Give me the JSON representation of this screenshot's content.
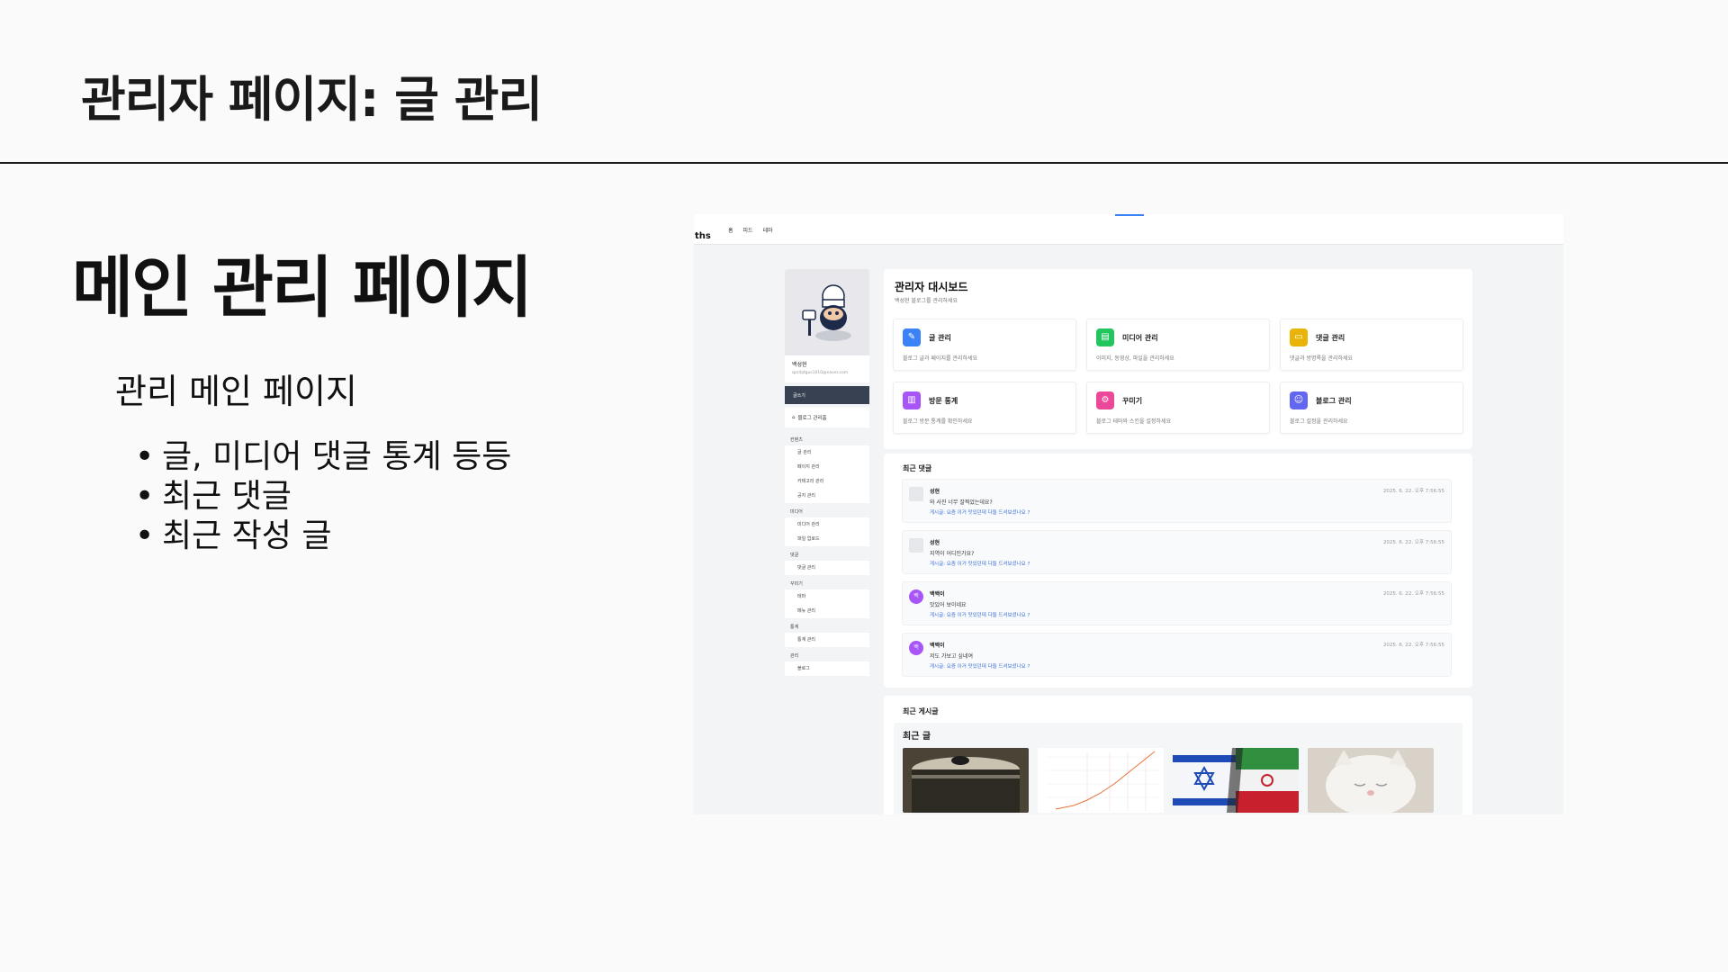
{
  "slide": {
    "title": "관리자 페이지: 글 관리",
    "heading": "메인 관리 페이지",
    "subheading": "관리 메인 페이지",
    "bullets": [
      "글, 미디어 댓글 통계 등등",
      "최근 댓글",
      "최근 작성 글"
    ]
  },
  "screenshot": {
    "logo": "ths",
    "nav": [
      "홈",
      "피드",
      "테마"
    ],
    "profile": {
      "name": "백성현",
      "email": "qoritjdgus1010@naver.com"
    },
    "write_button": "글쓰기",
    "blog_home": "블로그 관리홈",
    "sidebar": [
      {
        "section": "컨텐츠",
        "items": [
          "글 관리",
          "페이지 관리",
          "카테고리 관리",
          "공지 관리"
        ]
      },
      {
        "section": "미디어",
        "items": [
          "미디어 관리",
          "파일 업로드"
        ]
      },
      {
        "section": "댓글",
        "items": [
          "댓글 관리"
        ]
      },
      {
        "section": "꾸미기",
        "items": [
          "테마",
          "메뉴 관리"
        ]
      },
      {
        "section": "통계",
        "items": [
          "통계 관리"
        ]
      },
      {
        "section": "관리",
        "items": [
          "블로그"
        ]
      }
    ],
    "dashboard": {
      "title": "관리자 대시보드",
      "subtitle": "백성현 블로그를 관리하세요",
      "cards": [
        {
          "title": "글 관리",
          "desc": "블로그 글과 페이지를 관리하세요",
          "color": "#3b82f6",
          "icon": "edit-icon"
        },
        {
          "title": "미디어 관리",
          "desc": "이미지, 동영상, 파일을 관리하세요",
          "color": "#22c55e",
          "icon": "file-icon"
        },
        {
          "title": "댓글 관리",
          "desc": "댓글과 방명록을 관리하세요",
          "color": "#eab308",
          "icon": "comment-icon"
        },
        {
          "title": "방문 통계",
          "desc": "블로그 방문 통계를 확인하세요",
          "color": "#a855f7",
          "icon": "chart-icon"
        },
        {
          "title": "꾸미기",
          "desc": "블로그 테마와 스킨을 설정하세요",
          "color": "#ec4899",
          "icon": "gear-icon"
        },
        {
          "title": "블로그 관리",
          "desc": "블로그 설정을 관리하세요",
          "color": "#6366f1",
          "icon": "users-icon"
        }
      ]
    },
    "recent_comments": {
      "title": "최근 댓글",
      "items": [
        {
          "author": "성현",
          "text": "와 사진 너무 잘찍었는데요?",
          "post": "게시글: 요즘 이거 맛있던데 다들 드셔보셨나요 ?",
          "date": "2025. 6. 22. 오후 7:56:55",
          "avatar": "image"
        },
        {
          "author": "성현",
          "text": "지역이 어디인가요?",
          "post": "게시글: 요즘 이거 맛있던데 다들 드셔보셨나요 ?",
          "date": "2025. 6. 22. 오후 7:56:55",
          "avatar": "image"
        },
        {
          "author": "백백이",
          "text": "맛있어 보이네요",
          "post": "게시글: 요즘 이거 맛있던데 다들 드셔보셨나요 ?",
          "date": "2025. 6. 22. 오후 7:56:55",
          "avatar": "백"
        },
        {
          "author": "백백이",
          "text": "저도 가보고 싶네여",
          "post": "게시글: 요즘 이거 맛있던데 다들 드셔보셨나요 ?",
          "date": "2025. 6. 22. 오후 7:56:55",
          "avatar": "백"
        }
      ]
    },
    "recent_posts": {
      "title": "최근 게시글",
      "inner_title": "최근 글"
    }
  }
}
